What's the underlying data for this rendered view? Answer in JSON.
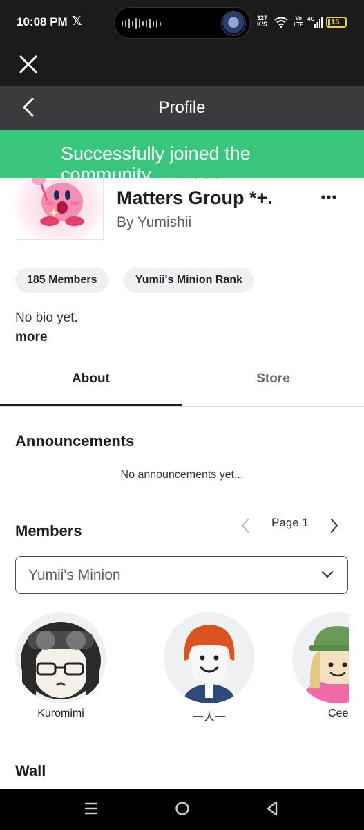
{
  "status_bar": {
    "time": "10:08 PM",
    "x_app_glyph": "𝕏",
    "net_speed_value": "327",
    "net_speed_unit": "K/S",
    "volte_top": "Vo",
    "volte_bottom": "LTE",
    "network": "4G",
    "battery": "15",
    "battery_color": "#e6d14d"
  },
  "header": {
    "title": "Profile",
    "background": "#3a3b3d"
  },
  "toast": {
    "message": "Successfully joined the community",
    "color": "#3ac67d"
  },
  "group": {
    "name_line1": "*+ Pinkness",
    "name_line2": "Matters Group *+.",
    "owner": "By Yumishii",
    "image_icon": "kirby-icon"
  },
  "chips": {
    "members": "185 Members",
    "rank": "Yumii's Minion Rank"
  },
  "bio": {
    "text": "No bio yet.",
    "more_label": "more"
  },
  "tabs": [
    {
      "label": "About",
      "active": true
    },
    {
      "label": "Store",
      "active": false
    }
  ],
  "announcements": {
    "heading": "Announcements",
    "empty_text": "No announcements yet..."
  },
  "members": {
    "heading": "Members",
    "page_label": "Page 1",
    "role_selected": "Yumii's Minion",
    "list": [
      {
        "name": "Kuromimi"
      },
      {
        "name": "一人一"
      },
      {
        "name": "Cee"
      }
    ]
  },
  "wall": {
    "heading": "Wall"
  }
}
